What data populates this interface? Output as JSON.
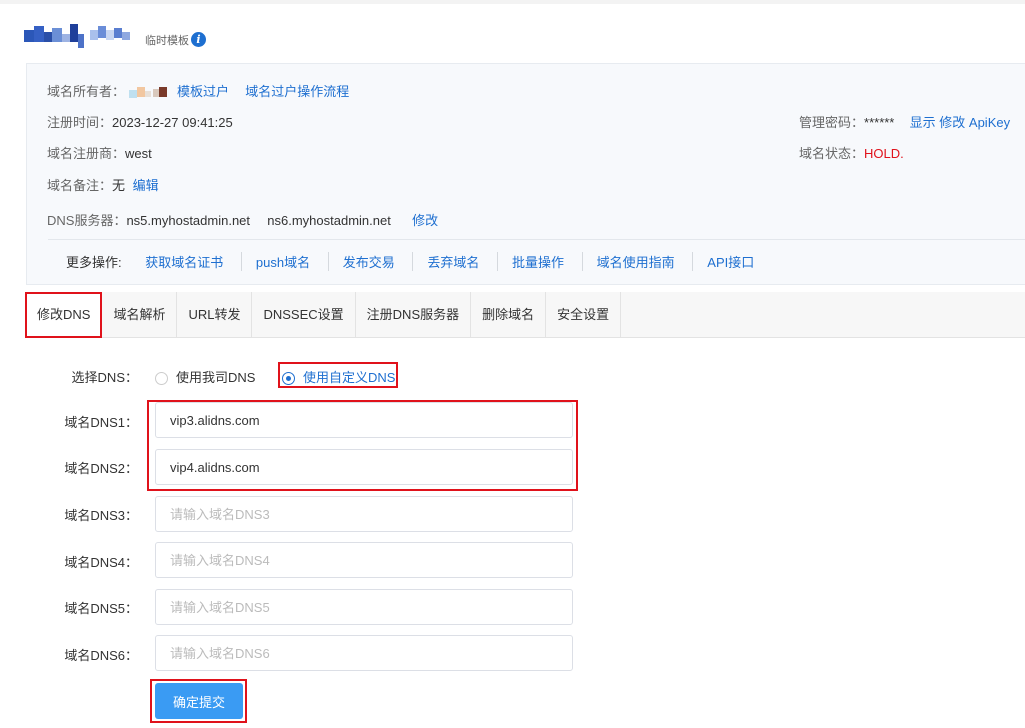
{
  "header": {
    "tag": "临时模板",
    "info_icon": "i"
  },
  "info": {
    "owner_label": "域名所有者：",
    "owner_link1": "模板过户",
    "owner_link2": "域名过户操作流程",
    "reg_time_label": "注册时间：",
    "reg_time_value": "2023-12-27 09:41:25",
    "registrar_label": "域名注册商：",
    "registrar_value": "west",
    "remark_label": "域名备注：",
    "remark_value": "无",
    "remark_edit": "编辑",
    "dns_label": "DNS服务器：",
    "dns1": "ns5.myhostadmin.net",
    "dns2": "ns6.myhostadmin.net",
    "dns_edit": "修改",
    "pwd_label": "管理密码：",
    "pwd_value": "******",
    "pwd_show": "显示",
    "pwd_edit": "修改",
    "apikey": "ApiKey",
    "status_label": "域名状态：",
    "status_value": "HOLD."
  },
  "more": {
    "label": "更多操作:",
    "items": [
      "获取域名证书",
      "push域名",
      "发布交易",
      "丢弃域名",
      "批量操作",
      "域名使用指南",
      "API接口"
    ]
  },
  "tabs": [
    "修改DNS",
    "域名解析",
    "URL转发",
    "DNSSEC设置",
    "注册DNS服务器",
    "删除域名",
    "安全设置"
  ],
  "form": {
    "select_label": "选择DNS：",
    "option1": "使用我司DNS",
    "option2": "使用自定义DNS",
    "dns1_label": "域名DNS1：",
    "dns2_label": "域名DNS2：",
    "dns3_label": "域名DNS3：",
    "dns4_label": "域名DNS4：",
    "dns5_label": "域名DNS5：",
    "dns6_label": "域名DNS6：",
    "dns1_value": "vip3.alidns.com",
    "dns2_value": "vip4.alidns.com",
    "dns3_placeholder": "请输入域名DNS3",
    "dns4_placeholder": "请输入域名DNS4",
    "dns5_placeholder": "请输入域名DNS5",
    "dns6_placeholder": "请输入域名DNS6",
    "submit": "确定提交"
  },
  "colors": {
    "link": "#1e6fd0",
    "status": "#e0121b",
    "highlight": "#e0121b",
    "button": "#3a9bf3"
  }
}
